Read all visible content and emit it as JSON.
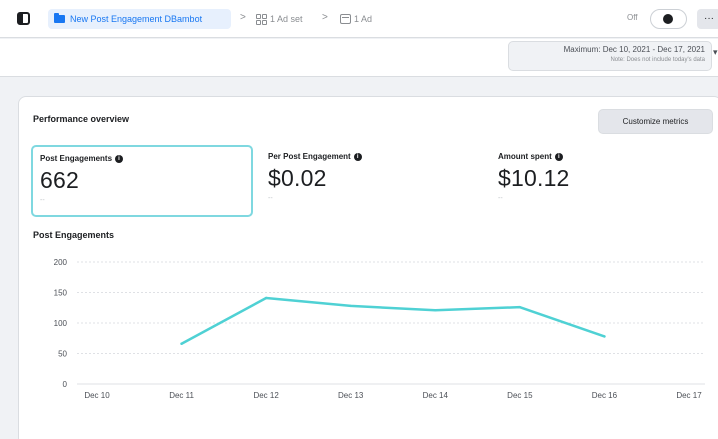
{
  "topbar": {
    "campaign_name": "New Post Engagement DBambot",
    "separator": ">",
    "adset_label": "1 Ad set",
    "ad_label": "1 Ad",
    "status_label": "Off",
    "more_label": "···"
  },
  "date": {
    "range": "Maximum: Dec 10, 2021 - Dec 17, 2021",
    "note": "Note: Does not include today's data"
  },
  "overview": {
    "title": "Performance overview",
    "customize_label": "Customize metrics",
    "metrics": [
      {
        "label": "Post Engagements",
        "value": "662",
        "sub": "--"
      },
      {
        "label": "Per Post Engagement",
        "value": "$0.02",
        "sub": "--"
      },
      {
        "label": "Amount spent",
        "value": "$10.12",
        "sub": "--"
      }
    ],
    "info_glyph": "i"
  },
  "chart_data": {
    "type": "line",
    "title": "Post Engagements",
    "xlabel": "",
    "ylabel": "",
    "categories": [
      "Dec 10",
      "Dec 11",
      "Dec 12",
      "Dec 13",
      "Dec 14",
      "Dec 15",
      "Dec 16",
      "Dec 17"
    ],
    "series": [
      {
        "values": [
          null,
          66,
          141,
          128,
          121,
          126,
          78,
          null
        ],
        "color": "#4fd1d4"
      }
    ],
    "yticks": [
      200,
      150,
      100,
      50,
      0
    ],
    "ylim": [
      0,
      200
    ],
    "grid": true,
    "legend": "none"
  },
  "colors": {
    "accent": "#1877f2",
    "line": "#4fd1d4",
    "selected_border": "#7fd8e0"
  }
}
